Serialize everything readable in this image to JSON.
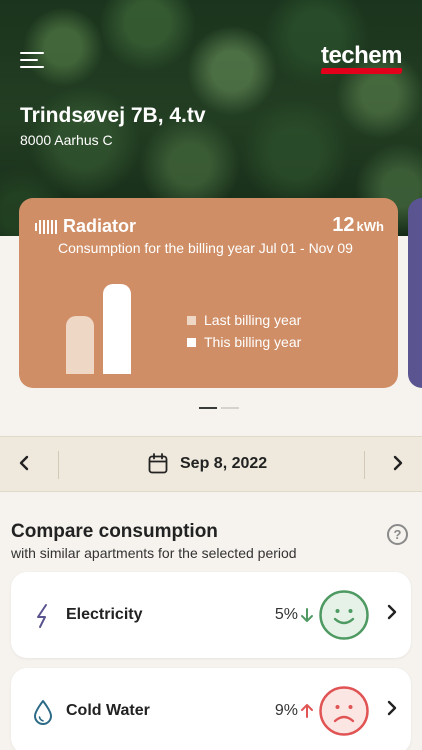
{
  "header": {
    "address": "Trindsøvej 7B, 4.tv",
    "city": "8000 Aarhus C",
    "logo_text": "techem"
  },
  "card": {
    "title": "Radiator",
    "value": "12",
    "unit": "kWh",
    "subtitle": "Consumption for the billing year Jul 01 - Nov 09",
    "legend_last": "Last billing year",
    "legend_this": "This billing year",
    "last_year_fraction": 0.64,
    "this_year_fraction": 1.0,
    "color": "#cf8e66",
    "next_card_color": "#5a5590"
  },
  "pager": {
    "current": 1,
    "total": 2
  },
  "date_bar": {
    "date": "Sep 8, 2022",
    "prev_icon": "chevron-left-icon",
    "next_icon": "chevron-right-icon",
    "calendar_icon": "calendar-icon"
  },
  "compare": {
    "title": "Compare consumption",
    "subtitle": "with similar apartments for the selected period",
    "help": "?",
    "items": [
      {
        "label": "Electricity",
        "percent": "5%",
        "trend": "down",
        "mood": "happy",
        "icon": "lightning-icon",
        "trend_color": "#4e9a62",
        "face_color": "#4e9a62"
      },
      {
        "label": "Cold Water",
        "percent": "9%",
        "trend": "up",
        "mood": "sad",
        "icon": "water-drop-icon",
        "trend_color": "#e05454",
        "face_color": "#e05454"
      }
    ]
  }
}
